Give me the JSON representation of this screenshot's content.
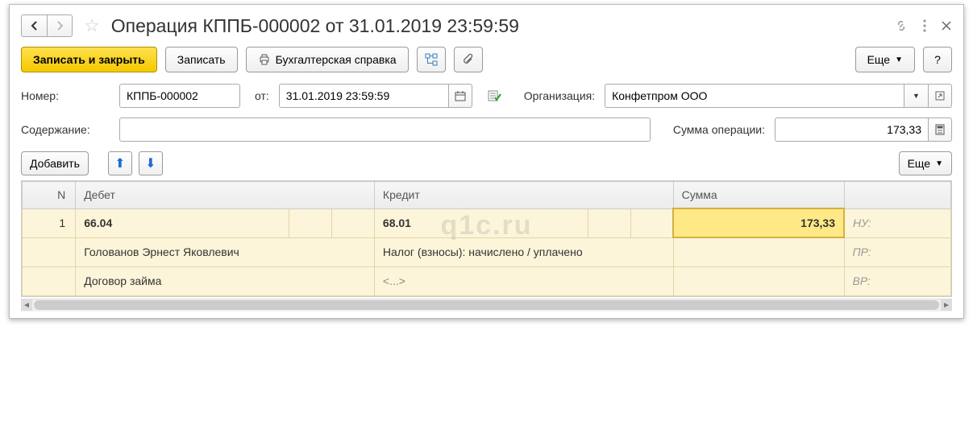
{
  "header": {
    "title": "Операция КППБ-000002 от 31.01.2019 23:59:59"
  },
  "toolbar": {
    "save_close": "Записать и закрыть",
    "save": "Записать",
    "print": "Бухгалтерская справка",
    "more": "Еще",
    "help": "?"
  },
  "form": {
    "number_label": "Номер:",
    "number": "КППБ-000002",
    "date_label": "от:",
    "date": "31.01.2019 23:59:59",
    "org_label": "Организация:",
    "org": "Конфетпром ООО",
    "content_label": "Содержание:",
    "content": "",
    "sum_label": "Сумма операции:",
    "sum": "173,33"
  },
  "actions": {
    "add": "Добавить",
    "more2": "Еще"
  },
  "table": {
    "headers": {
      "n": "N",
      "debit": "Дебет",
      "credit": "Кредит",
      "sum": "Сумма",
      "side": ""
    },
    "rows": [
      {
        "n": "1",
        "debit_acc": "66.04",
        "credit_acc": "68.01",
        "sum": "173,33",
        "side": "НУ:",
        "debit_sub1": "Голованов Эрнест Яковлевич",
        "credit_sub1": "Налог (взносы): начислено / уплачено",
        "side2": "ПР:",
        "debit_sub2": "Договор займа",
        "credit_sub2": "<...>",
        "side3": "ВР:"
      }
    ]
  },
  "watermark": "q1c.ru"
}
